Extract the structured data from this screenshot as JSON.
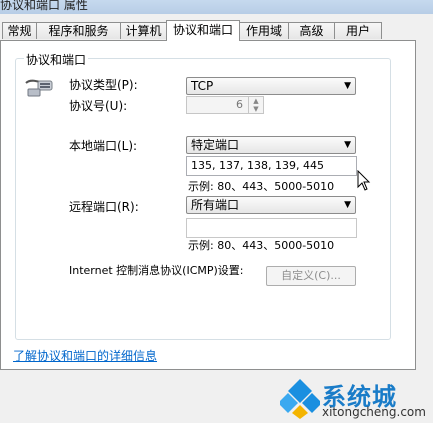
{
  "window": {
    "title": "协议和端口 属性"
  },
  "tabs": [
    {
      "label": "常规"
    },
    {
      "label": "程序和服务"
    },
    {
      "label": "计算机"
    },
    {
      "label": "协议和端口"
    },
    {
      "label": "作用域"
    },
    {
      "label": "高级"
    },
    {
      "label": "用户"
    }
  ],
  "active_tab": "协议和端口",
  "group": {
    "title": "协议和端口",
    "protocol_type_label": "协议类型(P):",
    "protocol_type_value": "TCP",
    "protocol_number_label": "协议号(U):",
    "protocol_number_value": "6",
    "local_port_label": "本地端口(L):",
    "local_port_value": "特定端口",
    "local_port_text": "135, 137, 138, 139, 445",
    "local_example": "示例: 80、443、5000-5010",
    "remote_port_label": "远程端口(R):",
    "remote_port_value": "所有端口",
    "remote_port_text": "",
    "remote_example": "示例: 80、443、5000-5010",
    "icmp_label": "Internet 控制消息协议(ICMP)设置:",
    "customize_button": "自定义(C)..."
  },
  "link": "了解协议和端口的详细信息",
  "watermark": {
    "title": "系统城",
    "subtitle": "xitongcheng.com"
  }
}
